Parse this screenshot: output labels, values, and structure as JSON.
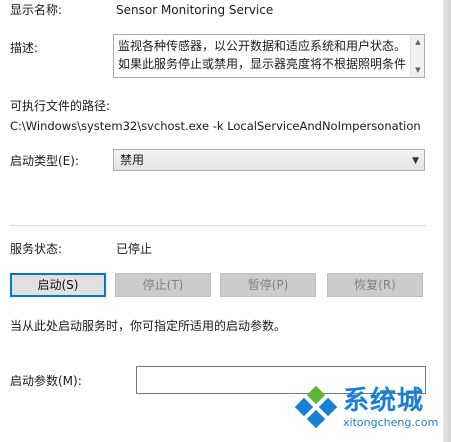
{
  "general": {
    "display_name_label": "显示名称:",
    "display_name_value": "Sensor Monitoring Service",
    "description_label": "描述:",
    "description_lines": [
      "监视各种传感器，以公开数据和适应系统和用户状态。",
      "如果此服务停止或禁用，显示器亮度将不根据照明条件"
    ],
    "exe_path_label": "可执行文件的路径:",
    "exe_path_value": "C:\\Windows\\system32\\svchost.exe -k LocalServiceAndNoImpersonation",
    "startup_type_label": "启动类型(E):",
    "startup_type_value": "禁用",
    "service_status_label": "服务状态:",
    "service_status_value": "已停止",
    "buttons": {
      "start": "启动(S)",
      "stop": "停止(T)",
      "pause": "暂停(P)",
      "resume": "恢复(R)"
    },
    "hint_text": "当从此处启动服务时，你可指定所适用的启动参数。",
    "start_params_label": "启动参数(M):",
    "start_params_value": ""
  },
  "watermark": {
    "title": "系统城",
    "subtitle": "xitongcheng.com"
  },
  "colors": {
    "accent": "#0078d7",
    "logo_blue": "#1a7fd6",
    "logo_green": "#5cb531"
  }
}
